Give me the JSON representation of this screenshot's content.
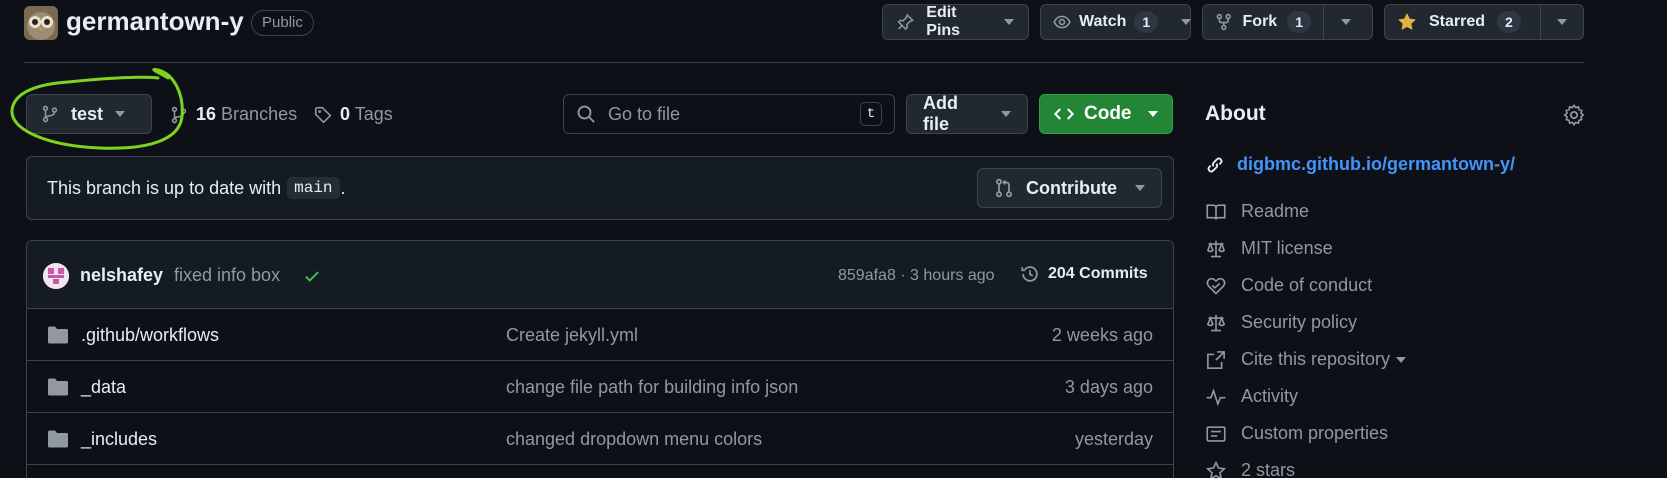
{
  "header": {
    "repo_name": "germantown-y",
    "visibility": "Public",
    "edit_pins_label": "Edit Pins",
    "watch_label": "Watch",
    "watch_count": "1",
    "fork_label": "Fork",
    "fork_count": "1",
    "starred_label": "Starred",
    "starred_count": "2"
  },
  "branch": {
    "current": "test",
    "branches_count": "16",
    "branches_label": "Branches",
    "tags_count": "0",
    "tags_label": "Tags"
  },
  "search": {
    "placeholder": "Go to file",
    "shortcut": "t"
  },
  "actions": {
    "add_file_label": "Add file",
    "code_label": "Code"
  },
  "status": {
    "text": "This branch is up to date with",
    "branch": "main",
    "suffix": ".",
    "contribute_label": "Contribute"
  },
  "latest_commit": {
    "user": "nelshafey",
    "message": "fixed info box",
    "sha_time": "859afa8 · 3 hours ago",
    "commits_label": "204 Commits"
  },
  "files": [
    {
      "name": ".github/workflows",
      "message": "Create jekyll.yml",
      "date": "2 weeks ago"
    },
    {
      "name": "_data",
      "message": "change file path for building info json",
      "date": "3 days ago"
    },
    {
      "name": "_includes",
      "message": "changed dropdown menu colors",
      "date": "yesterday"
    }
  ],
  "about": {
    "title": "About",
    "website": "digbmc.github.io/germantown-y/",
    "items": [
      {
        "icon": "book-icon",
        "label": "Readme"
      },
      {
        "icon": "law-icon",
        "label": "MIT license"
      },
      {
        "icon": "code-of-conduct-icon",
        "label": "Code of conduct"
      },
      {
        "icon": "law-icon",
        "label": "Security policy"
      },
      {
        "icon": "cite-icon",
        "label": "Cite this repository"
      },
      {
        "icon": "pulse-icon",
        "label": "Activity"
      },
      {
        "icon": "note-icon",
        "label": "Custom properties"
      },
      {
        "icon": "star-icon",
        "label": "2 stars"
      }
    ]
  },
  "colors": {
    "background": "#0d1117",
    "accent_green": "#238636",
    "link_blue": "#4493f8",
    "annotation": "#7ed321",
    "star_yellow": "#e3b341"
  }
}
